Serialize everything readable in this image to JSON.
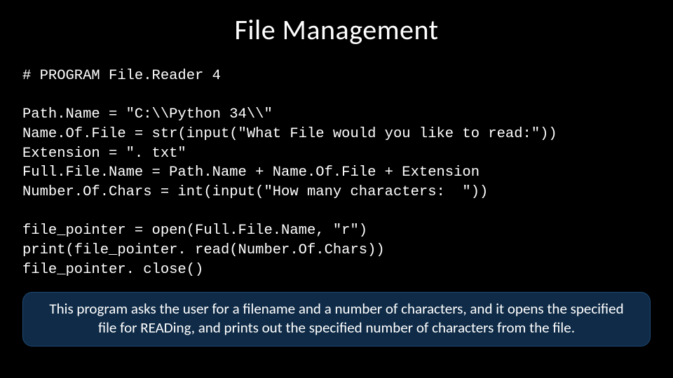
{
  "slide": {
    "title": "File Management",
    "code": "# PROGRAM File.Reader 4\n\nPath.Name = \"C:\\\\Python 34\\\\\"\nName.Of.File = str(input(\"What File would you like to read:\"))\nExtension = \". txt\"\nFull.File.Name = Path.Name + Name.Of.File + Extension\nNumber.Of.Chars = int(input(\"How many characters:  \"))\n\nfile_pointer = open(Full.File.Name, \"r\")\nprint(file_pointer. read(Number.Of.Chars))\nfile_pointer. close()",
    "callout": "This program asks the user for a filename and a number of characters, and it opens the specified file for READing, and prints out the specified number of characters from the file."
  }
}
